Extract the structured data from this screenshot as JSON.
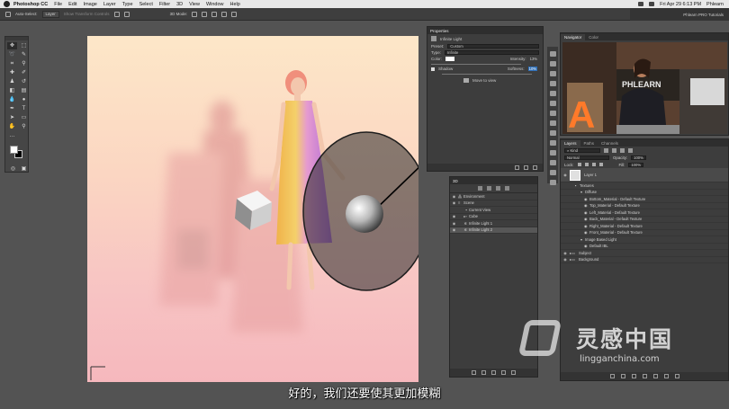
{
  "menubar": {
    "app_name": "Photoshop CC",
    "items": [
      "File",
      "Edit",
      "Image",
      "Layer",
      "Type",
      "Select",
      "Filter",
      "3D",
      "View",
      "Window",
      "Help"
    ],
    "clock": "Fri Apr 29  6:13 PM",
    "user": "Phlearn"
  },
  "options_bar": {
    "auto_select_label": "Auto-Select:",
    "auto_select_value": "Layer",
    "show_transform": "Show Transform Controls",
    "mode_3d": "3D Mode:",
    "workspace": "Phlearn PRO Tutorials"
  },
  "properties": {
    "title": "Properties",
    "type_label": "Infinite Light",
    "preset_label": "Preset:",
    "preset_value": "Custom",
    "type_field_label": "Type:",
    "type_value": "Infinite",
    "color_label": "Color:",
    "color_value": "#ffffff",
    "intensity_label": "Intensity:",
    "intensity_value": "13%",
    "shadow_label": "Shadow",
    "softness_label": "Softness:",
    "softness_value": "10%",
    "move_to_view": "Move to view"
  },
  "panel_3d": {
    "title": "3D",
    "rows": [
      {
        "label": "Environment",
        "indent": 0,
        "selected": false
      },
      {
        "label": "Scene",
        "indent": 0,
        "selected": false
      },
      {
        "label": "Current View",
        "indent": 1,
        "selected": false
      },
      {
        "label": "Cube",
        "indent": 1,
        "selected": false
      },
      {
        "label": "Infinite Light 1",
        "indent": 1,
        "selected": false
      },
      {
        "label": "Infinite Light 2",
        "indent": 1,
        "selected": true
      }
    ]
  },
  "navigator": {
    "tabs": [
      "Navigator",
      "Color"
    ],
    "video_sign": "PHLEARN",
    "video_letter": "A"
  },
  "layers": {
    "tabs": [
      "Layers",
      "Paths",
      "Channels"
    ],
    "kind_label": "Kind",
    "blend_mode": "Normal",
    "opacity_label": "Opacity:",
    "opacity_value": "100%",
    "lock_label": "Lock:",
    "fill_label": "Fill:",
    "fill_value": "100%",
    "items": [
      {
        "label": "Layer 1",
        "indent": 0,
        "main": true
      },
      {
        "label": "Textures",
        "indent": 1,
        "main": false
      },
      {
        "label": "Diffuse",
        "indent": 2,
        "main": false
      },
      {
        "label": "Bottom_Material - Default Texture",
        "indent": 3,
        "main": false
      },
      {
        "label": "Top_Material - Default Texture",
        "indent": 3,
        "main": false
      },
      {
        "label": "Left_Material - Default Texture",
        "indent": 3,
        "main": false
      },
      {
        "label": "Back_Material - Default Texture",
        "indent": 3,
        "main": false
      },
      {
        "label": "Right_Material - Default Texture",
        "indent": 3,
        "main": false
      },
      {
        "label": "Front_Material - Default Texture",
        "indent": 3,
        "main": false
      },
      {
        "label": "Image Based Light",
        "indent": 2,
        "main": false
      },
      {
        "label": "Default IBL",
        "indent": 3,
        "main": false
      },
      {
        "label": "Subject",
        "indent": 0,
        "main": false
      },
      {
        "label": "Background",
        "indent": 0,
        "main": false
      }
    ]
  },
  "subtitle": "好的，我们还要使其更加模糊",
  "watermark": {
    "cn": "灵感中国",
    "url": "lingganchina.com"
  }
}
